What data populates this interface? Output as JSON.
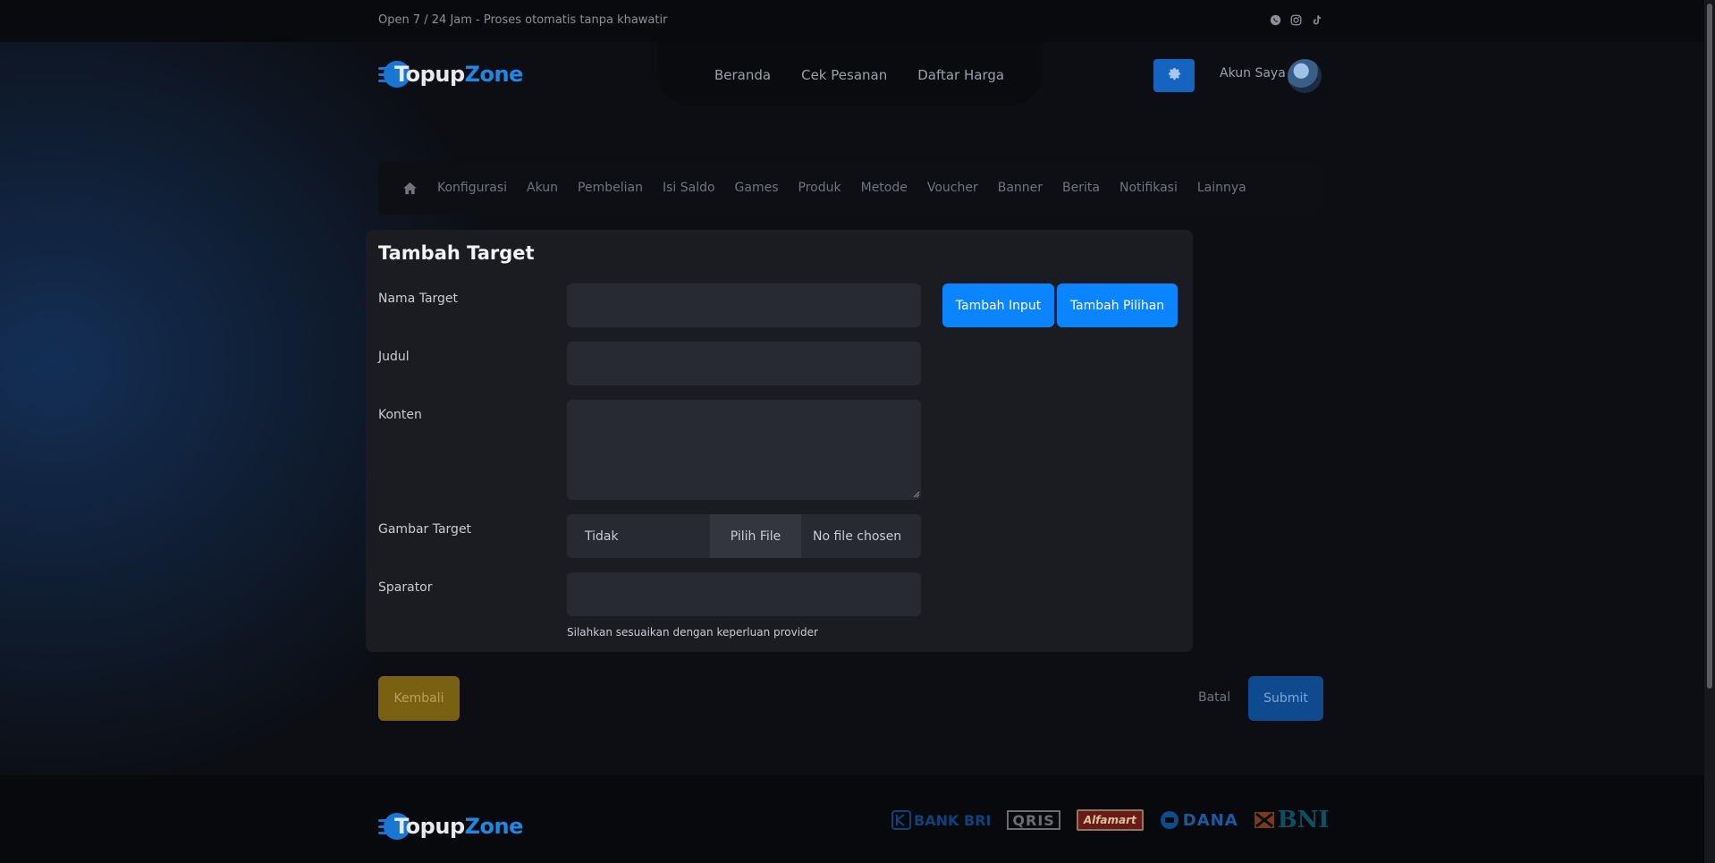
{
  "topbar": {
    "announcement": "Open 7 / 24 Jam - Proses otomatis tanpa khawatir",
    "social_icons": [
      "whatsapp-icon",
      "instagram-icon",
      "tiktok-icon"
    ]
  },
  "brand": {
    "name_part1": "Topup",
    "name_part2": "Zone",
    "accent": "#1e88e5"
  },
  "nav": {
    "links": [
      "Beranda",
      "Cek Pesanan",
      "Daftar Harga"
    ],
    "settings_icon": "gear-icon",
    "account_label": "Akun Saya"
  },
  "admin_menu": {
    "home_icon": "home-icon",
    "items": [
      "Konfigurasi",
      "Akun",
      "Pembelian",
      "Isi Saldo",
      "Games",
      "Produk",
      "Metode",
      "Voucher",
      "Banner",
      "Berita",
      "Notifikasi",
      "Lainnya"
    ]
  },
  "form": {
    "title": "Tambah Target",
    "fields": {
      "nama_target": {
        "label": "Nama Target",
        "value": ""
      },
      "judul": {
        "label": "Judul",
        "value": ""
      },
      "konten": {
        "label": "Konten",
        "value": ""
      },
      "gambar_target": {
        "label": "Gambar Target",
        "selected": "Tidak",
        "file_button": "Pilih File",
        "file_status": "No file chosen"
      },
      "sparator": {
        "label": "Sparator",
        "value": "",
        "hint": "Silahkan sesuaikan dengan keperluan provider"
      }
    },
    "buttons": {
      "add_input": "Tambah Input",
      "add_option": "Tambah Pilihan"
    }
  },
  "actions": {
    "back": "Kembali",
    "cancel": "Batal",
    "submit": "Submit"
  },
  "footer": {
    "payment_logos": [
      "BANK BRI",
      "QRIS",
      "Alfamart",
      "DANA",
      "BNI"
    ]
  },
  "colors": {
    "primary_button": "#0a84ff",
    "back_button": "#7a6012",
    "submit_button": "#0f4a8f"
  }
}
